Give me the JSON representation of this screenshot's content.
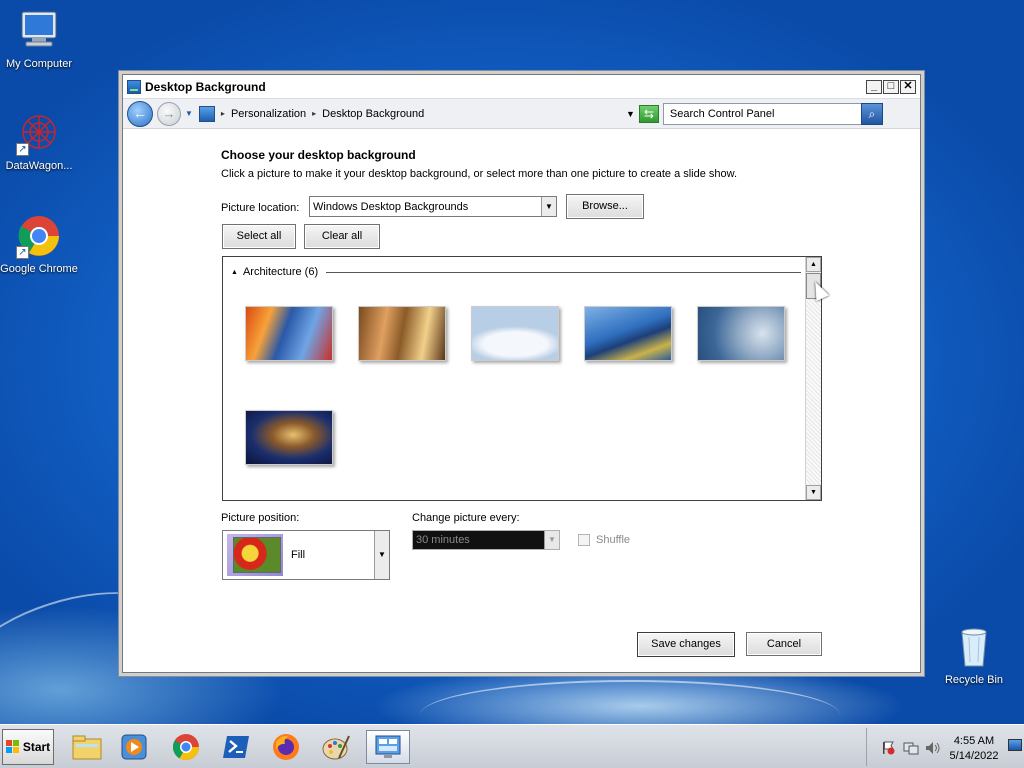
{
  "desktop": {
    "icons": [
      {
        "label": "My Computer",
        "icon": "my-computer-icon"
      },
      {
        "label": "DataWagon...",
        "icon": "datawagon-icon"
      },
      {
        "label": "Google Chrome",
        "icon": "chrome-icon"
      },
      {
        "label": "Recycle Bin",
        "icon": "recycle-bin-icon"
      }
    ]
  },
  "window": {
    "title": "Desktop Background",
    "controls": {
      "minimize": "_",
      "maximize": "□",
      "close": "✕"
    },
    "address": {
      "crumbs": [
        "Personalization",
        "Desktop Background"
      ],
      "search_placeholder": "Search Control Panel"
    },
    "content": {
      "heading": "Choose your desktop background",
      "subheading": "Click a picture to make it your desktop background, or select more than one picture to create a slide show.",
      "picture_location_label": "Picture location:",
      "picture_location_value": "Windows Desktop Backgrounds",
      "browse_label": "Browse...",
      "select_all_label": "Select all",
      "clear_all_label": "Clear all",
      "group_title": "Architecture (6)",
      "thumbnails": [
        "architecture-1",
        "architecture-2",
        "architecture-3",
        "architecture-4",
        "architecture-5",
        "architecture-6"
      ],
      "picture_position_label": "Picture position:",
      "picture_position_value": "Fill",
      "change_every_label": "Change picture every:",
      "change_every_value": "30 minutes",
      "shuffle_label": "Shuffle",
      "shuffle_checked": false,
      "save_label": "Save changes",
      "cancel_label": "Cancel"
    }
  },
  "taskbar": {
    "start_label": "Start",
    "pinned": [
      "explorer-icon",
      "media-player-icon",
      "chrome-icon",
      "powershell-icon",
      "firefox-icon",
      "paint-icon",
      "control-panel-icon"
    ],
    "clock": {
      "time": "4:55 AM",
      "date": "5/14/2022"
    }
  },
  "colors": {
    "desktop_blue": "#1363c9",
    "title_blue": "#1a5cb0"
  }
}
